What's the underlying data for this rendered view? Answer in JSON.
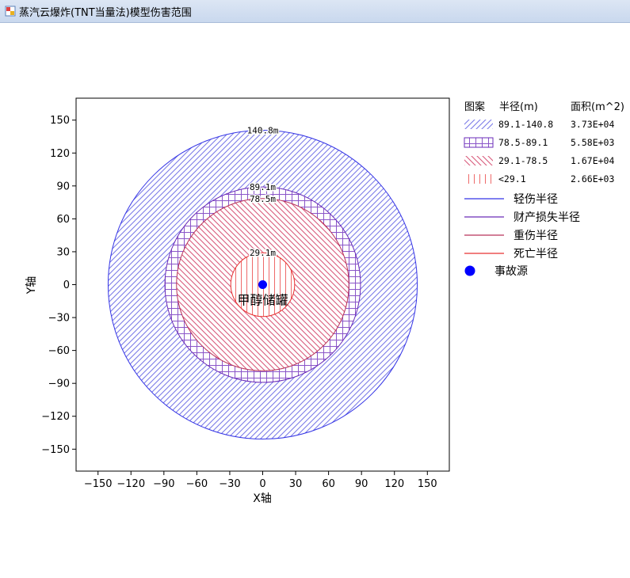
{
  "window": {
    "title": "蒸汽云爆炸(TNT当量法)模型伤害范围"
  },
  "colors": {
    "light_injury": "#3535e6",
    "property_loss": "#6a2bb8",
    "severe_injury": "#b8335a",
    "death": "#e83030",
    "source": "#0000ff",
    "hatch_light": "#7a7ae8",
    "hatch_property": "#8a55c8",
    "hatch_severe": "#d85a7a",
    "hatch_death": "#ee6a6a"
  },
  "chart_data": {
    "type": "area",
    "xlabel": "X轴",
    "ylabel": "Y轴",
    "xlim": [
      -170,
      170
    ],
    "ylim": [
      -170,
      170
    ],
    "xticks": [
      -150,
      -120,
      -90,
      -60,
      -30,
      0,
      30,
      60,
      90,
      120,
      150
    ],
    "yticks": [
      150,
      120,
      90,
      60,
      30,
      0,
      -30,
      -60,
      -90,
      -120,
      -150
    ],
    "circles": [
      {
        "radius": 140.8,
        "label": "140.8m",
        "kind": "light"
      },
      {
        "radius": 89.1,
        "label": "89.1m",
        "kind": "property"
      },
      {
        "radius": 78.5,
        "label": "78.5m",
        "kind": "severe"
      },
      {
        "radius": 29.1,
        "label": "29.1m",
        "kind": "death"
      }
    ],
    "source": {
      "x": 0,
      "y": 0,
      "label": "甲醇储罐"
    },
    "legend": {
      "headers": [
        "图案",
        "半径(m)",
        "面积(m^2)"
      ],
      "rows": [
        {
          "pattern": "light",
          "range": "89.1-140.8",
          "area": "3.73E+04"
        },
        {
          "pattern": "property",
          "range": "78.5-89.1",
          "area": "5.58E+03"
        },
        {
          "pattern": "severe",
          "range": "29.1-78.5",
          "area": "1.67E+04"
        },
        {
          "pattern": "death",
          "range": "<29.1",
          "area": "2.66E+03"
        }
      ],
      "lines": [
        {
          "kind": "light",
          "label": "轻伤半径"
        },
        {
          "kind": "property",
          "label": "财产损失半径"
        },
        {
          "kind": "severe",
          "label": "重伤半径"
        },
        {
          "kind": "death",
          "label": "死亡半径"
        }
      ],
      "marker_label": "事故源"
    }
  }
}
